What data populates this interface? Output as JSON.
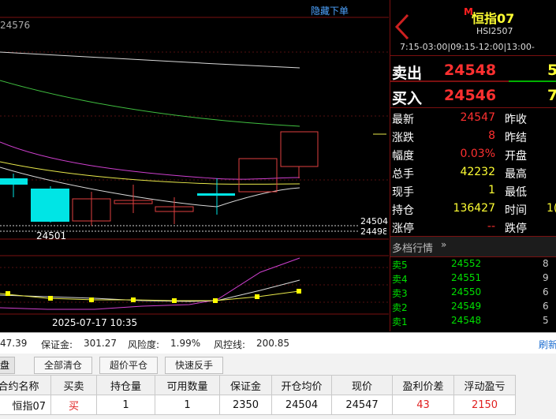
{
  "chart": {
    "hide_orders_link": "隐藏下单",
    "top_price": "24576",
    "price_tag_1": "24504",
    "price_tag_2": "24498",
    "low_label": "24501",
    "time_label": "2025-07-17 10:35"
  },
  "header": {
    "contract_name": "恒指07",
    "contract_code": "HSI2507",
    "trading_hours": "7:15-03:00|09:15-12:00|13:00-",
    "badge": "M"
  },
  "quote": {
    "ask_label": "卖出",
    "ask_price": "24548",
    "ask_volume": "5",
    "bid_label": "买入",
    "bid_price": "24546",
    "bid_volume": "7",
    "rows": [
      {
        "label": "最新",
        "value": "24547",
        "label2": "昨收",
        "value2": ""
      },
      {
        "label": "涨跌",
        "value": "8",
        "label2": "昨结",
        "value2": ""
      },
      {
        "label": "幅度",
        "value": "0.03%",
        "label2": "开盘",
        "value2": ""
      },
      {
        "label": "总手",
        "value": "42232",
        "label2": "最高",
        "value2": ""
      },
      {
        "label": "现手",
        "value": "1",
        "label2": "最低",
        "value2": ""
      },
      {
        "label": "持仓",
        "value": "136427",
        "label2": "时间",
        "value2": "1("
      },
      {
        "label": "涨停",
        "value": "--",
        "label2": "跌停",
        "value2": ""
      }
    ],
    "depth_title": "多档行情",
    "depth": [
      {
        "label": "卖5",
        "price": "24552",
        "volume": "8"
      },
      {
        "label": "卖4",
        "price": "24551",
        "volume": "9"
      },
      {
        "label": "卖3",
        "price": "24550",
        "volume": "6"
      },
      {
        "label": "卖2",
        "price": "24549",
        "volume": "6"
      },
      {
        "label": "卖1",
        "price": "24548",
        "volume": "5"
      }
    ]
  },
  "account": {
    "balance_fragment": "47.39",
    "margin_label": "保证金:",
    "margin_value": "301.27",
    "risk_label": "风险度:",
    "risk_value": "1.99%",
    "riskline_label": "风控线:",
    "riskline_value": "200.85",
    "refresh_label": "刷新"
  },
  "toolbar": {
    "tab_fragment": "仓盘",
    "close_all": "全部清仓",
    "over_close": "超价平仓",
    "reverse": "快速反手"
  },
  "positions": {
    "columns": [
      "合约名称",
      "买卖",
      "持仓量",
      "可用数量",
      "保证金",
      "开仓均价",
      "现价",
      "盈利价差",
      "浮动盈亏"
    ],
    "rows": [
      [
        "恒指07",
        "买",
        "1",
        "1",
        "2350",
        "24504",
        "24547",
        "43",
        "2150"
      ]
    ]
  },
  "colors": {
    "up": "#ff3030",
    "down": "#00e5e5",
    "ma_white": "#e0e0e0",
    "ma_yellow": "#e8e84a",
    "ma_magenta": "#d040d0",
    "ma_green": "#40c040"
  }
}
